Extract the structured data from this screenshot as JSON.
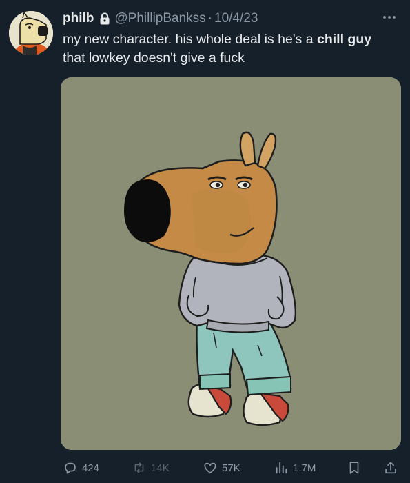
{
  "author": {
    "name": "philb",
    "handle": "@PhillipBankss",
    "separator": "·",
    "date": "10/4/23",
    "verified_lock": "lock-icon"
  },
  "tweet": {
    "text_part1": "my new character. his whole deal is he's a ",
    "text_bold": "chill guy",
    "text_part2": " that lowkey doesn't give a fuck"
  },
  "media": {
    "background": "#898e74"
  },
  "actions": {
    "replies": "424",
    "retweets": "14K",
    "likes": "57K",
    "views": "1.7M"
  },
  "colors": {
    "background": "#16202b",
    "text": "#e7e9ea",
    "muted": "#8b98a5"
  }
}
